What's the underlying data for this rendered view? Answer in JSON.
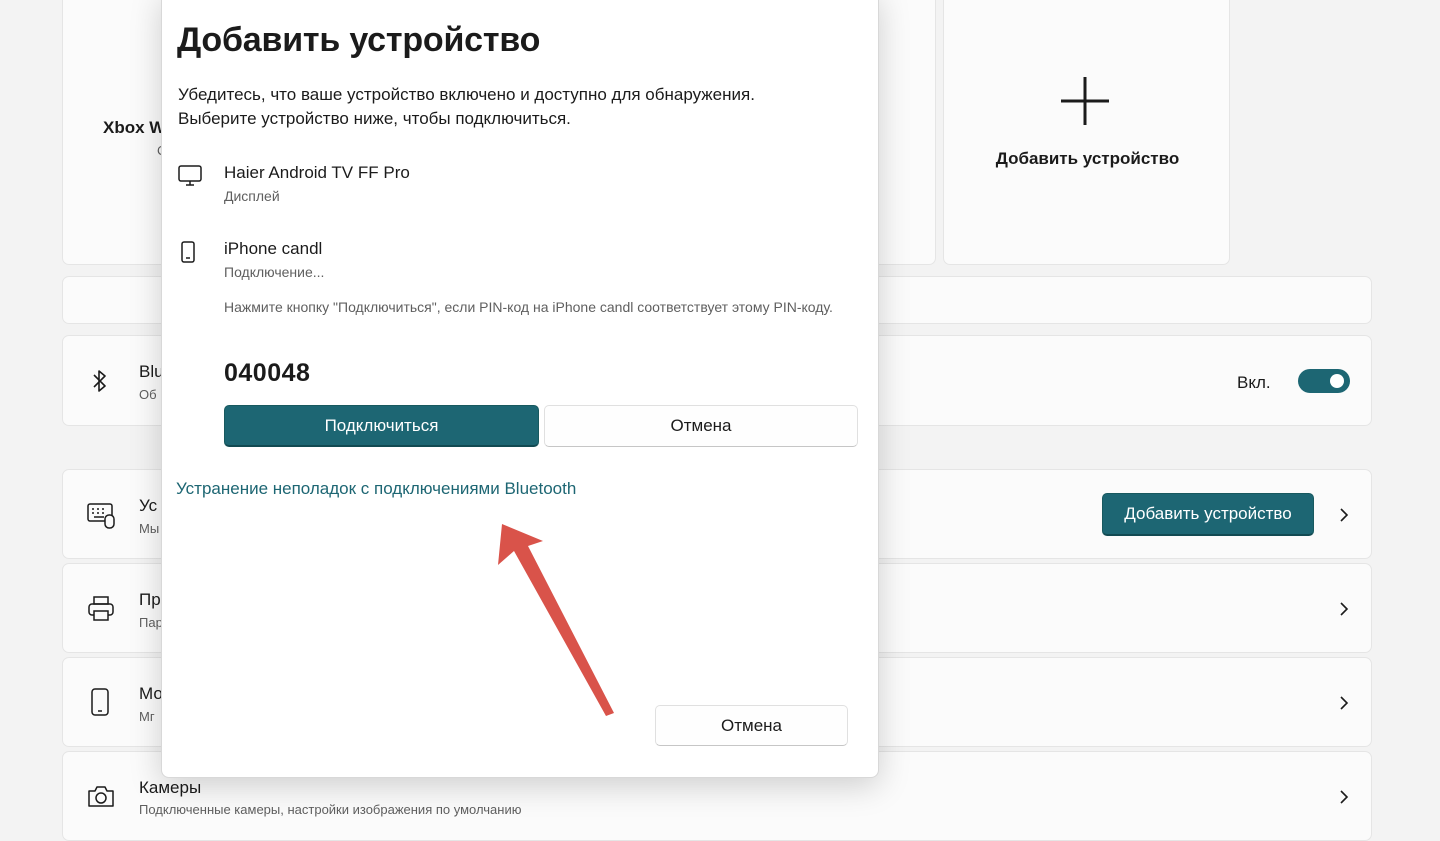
{
  "background": {
    "top_card_xbox": {
      "title_partial": "Xbox W",
      "sub_partial": "С"
    },
    "top_card_more": {
      "more_glyph": "···"
    },
    "add_card": {
      "label": "Добавить устройство"
    },
    "bluetooth_row": {
      "title_partial": "Blu",
      "sub_partial": "Об",
      "toggle_label": "Вкл.",
      "toggle_on": true
    },
    "devices_row": {
      "title_partial": "Ус",
      "sub_partial": "Мы",
      "add_button": "Добавить устройство"
    },
    "printers_row": {
      "title_partial": "Пр",
      "sub_partial": "Пар"
    },
    "mobile_row": {
      "title_partial": "Мо",
      "sub_partial": "Мг"
    },
    "cameras_row": {
      "title": "Камеры",
      "sub": "Подключенные камеры, настройки изображения по умолчанию"
    }
  },
  "dialog": {
    "title": "Добавить устройство",
    "description_line1": "Убедитесь, что ваше устройство включено и доступно для обнаружения.",
    "description_line2": "Выберите устройство ниже, чтобы подключиться.",
    "devices": [
      {
        "name": "Haier Android TV FF Pro",
        "type": "Дисплей",
        "icon": "monitor-icon"
      },
      {
        "name": "iPhone candl",
        "type": "Подключение...",
        "icon": "phone-icon"
      }
    ],
    "pin_note": "Нажмите кнопку \"Подключиться\", если PIN-код на iPhone candl соответствует этому PIN-коду.",
    "pin": "040048",
    "connect_button": "Подключиться",
    "cancel_inline_button": "Отмена",
    "troubleshoot_link": "Устранение неполадок с подключениями Bluetooth",
    "cancel_button": "Отмена"
  },
  "colors": {
    "accent": "#1d6673",
    "annotation_arrow": "#d9534a"
  }
}
